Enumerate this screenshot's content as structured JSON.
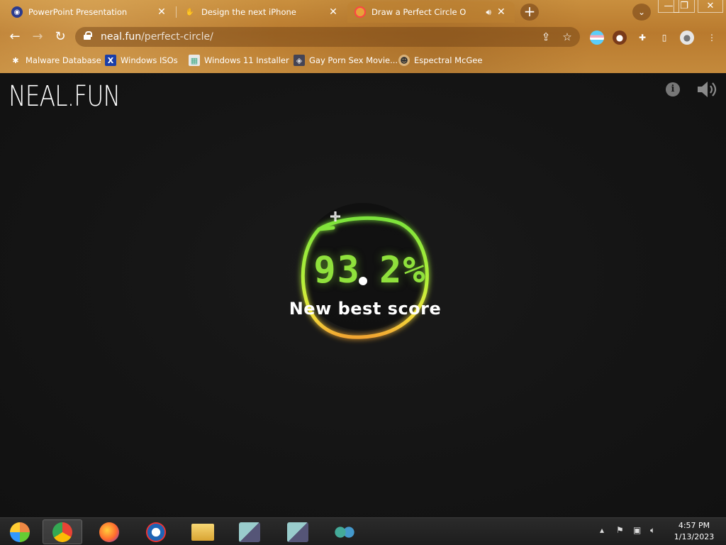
{
  "browser": {
    "tabs": [
      {
        "title": "PowerPoint Presentation",
        "icon": "globe-icon",
        "active": false
      },
      {
        "title": "Design the next iPhone",
        "icon": "hand-icon",
        "active": false
      },
      {
        "title": "Draw a Perfect Circle O",
        "icon": "circle-icon",
        "active": true
      }
    ],
    "new_tab_glyph": "+",
    "tab_search_glyph": "⌄",
    "window_controls": [
      "—",
      "❐",
      "✕"
    ],
    "url_host": "neal.fun",
    "url_path": "/perfect-circle/",
    "bookmarks": [
      {
        "label": "Malware Database",
        "icon": "bug-icon"
      },
      {
        "label": "Windows ISOs",
        "icon": "x-icon"
      },
      {
        "label": "Windows 11 Installer",
        "icon": "image-icon"
      },
      {
        "label": "Gay Porn Sex Movie...",
        "icon": "app-icon"
      },
      {
        "label": "Espectral McGee",
        "icon": "avatar-icon"
      }
    ]
  },
  "page": {
    "logo": "NEAL.FUN",
    "info_glyph": "i",
    "score": "93",
    "score_decimal": "2%",
    "message": "New best score"
  },
  "taskbar": {
    "time": "4:57 PM",
    "date": "1/13/2023"
  },
  "colors": {
    "accent_green": "#8fe13c",
    "page_bg": "#121212",
    "chrome_theme": "#c08535"
  }
}
